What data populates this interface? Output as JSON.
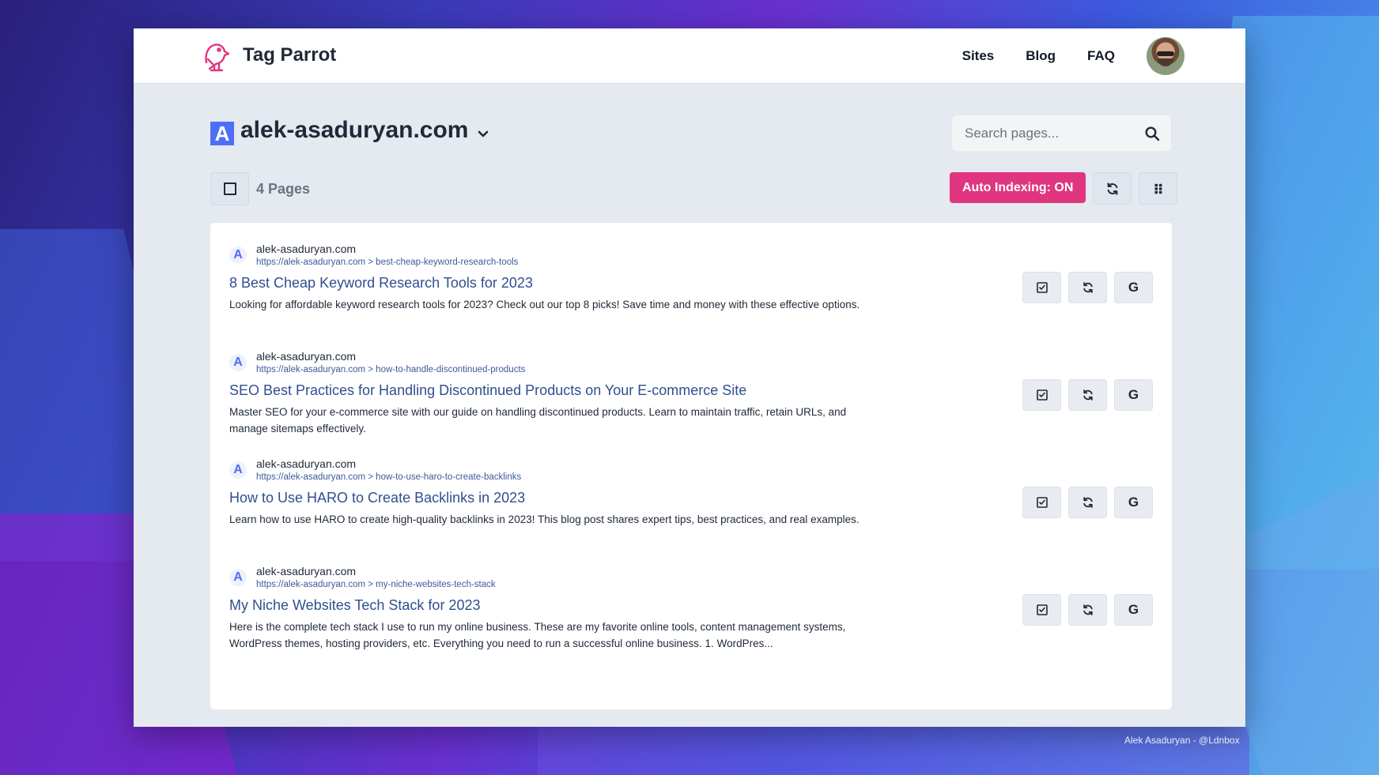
{
  "app": {
    "brand": "Tag Parrot",
    "nav": [
      "Sites",
      "Blog",
      "FAQ"
    ]
  },
  "site": {
    "badge": "A",
    "name": "alek-asaduryan.com"
  },
  "search": {
    "placeholder": "Search pages..."
  },
  "toolbar": {
    "pages_count": "4 Pages",
    "auto_indexing": "Auto Indexing: ON"
  },
  "colors": {
    "accent": "#e0357f",
    "link": "#2f4f8f",
    "site_badge": "#4f6ef7"
  },
  "pages": [
    {
      "domain": "alek-asaduryan.com",
      "url": "https://alek-asaduryan.com > best-cheap-keyword-research-tools",
      "title": "8 Best Cheap Keyword Research Tools for 2023",
      "description": "Looking for affordable keyword research tools for 2023? Check out our top 8 picks! Save time and money with these effective options."
    },
    {
      "domain": "alek-asaduryan.com",
      "url": "https://alek-asaduryan.com > how-to-handle-discontinued-products",
      "title": "SEO Best Practices for Handling Discontinued Products on Your E-commerce Site",
      "description": "Master SEO for your e-commerce site with our guide on handling discontinued products. Learn to maintain traffic, retain URLs, and manage sitemaps effectively."
    },
    {
      "domain": "alek-asaduryan.com",
      "url": "https://alek-asaduryan.com > how-to-use-haro-to-create-backlinks",
      "title": "How to Use HARO to Create Backlinks in 2023",
      "description": "Learn how to use HARO to create high-quality backlinks in 2023! This blog post shares expert tips, best practices, and real examples."
    },
    {
      "domain": "alek-asaduryan.com",
      "url": "https://alek-asaduryan.com > my-niche-websites-tech-stack",
      "title": "My Niche Websites Tech Stack for 2023",
      "description": "Here is the complete tech stack I use to run my online business. These are my favorite online tools, content management systems, WordPress themes, hosting providers, etc. Everything you need to run a successful online business. 1. WordPres..."
    }
  ],
  "page_actions": {
    "google_letter": "G"
  },
  "credit": "Alek Asaduryan - @Ldnbox"
}
